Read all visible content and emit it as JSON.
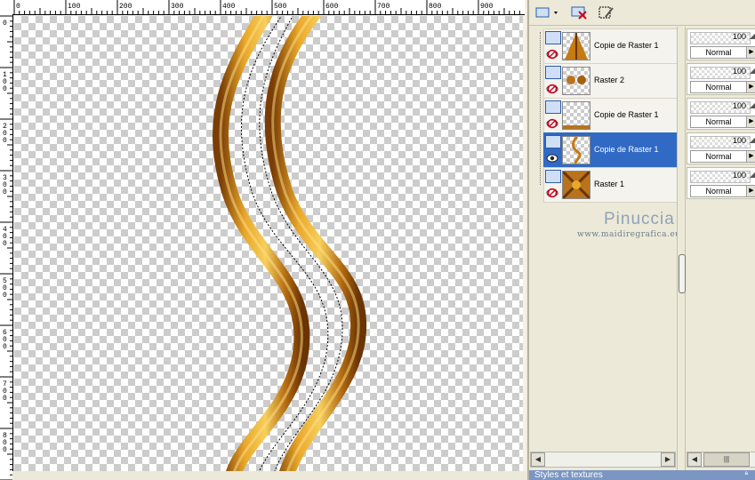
{
  "ruler": {
    "h_labels": [
      "0",
      "100",
      "200",
      "300",
      "400",
      "500",
      "600",
      "700",
      "800",
      "900"
    ],
    "v_labels": [
      "0",
      "100",
      "200",
      "300",
      "400",
      "500",
      "600",
      "700",
      "800"
    ]
  },
  "layers": [
    {
      "name": "Copie de Raster 1",
      "selected": false,
      "visible": false
    },
    {
      "name": "Raster 2",
      "selected": false,
      "visible": false
    },
    {
      "name": "Copie de Raster 1",
      "selected": false,
      "visible": false
    },
    {
      "name": "Copie de Raster 1",
      "selected": true,
      "visible": true
    },
    {
      "name": "Raster 1",
      "selected": false,
      "visible": false
    }
  ],
  "properties": [
    {
      "opacity": "100",
      "blend": "Normal"
    },
    {
      "opacity": "100",
      "blend": "Normal"
    },
    {
      "opacity": "100",
      "blend": "Normal"
    },
    {
      "opacity": "100",
      "blend": "Normal"
    },
    {
      "opacity": "100",
      "blend": "Normal"
    }
  ],
  "watermark": {
    "name": "Pinuccia",
    "url": "www.maidiregrafica.eu"
  },
  "bottom_panel": {
    "label": "Styles et textures",
    "pin": "ª"
  },
  "colors": {
    "accent": "#316ac5",
    "ribbon_dark": "#8a4a0a",
    "ribbon_mid": "#c9861a",
    "ribbon_light": "#f2c24a"
  }
}
